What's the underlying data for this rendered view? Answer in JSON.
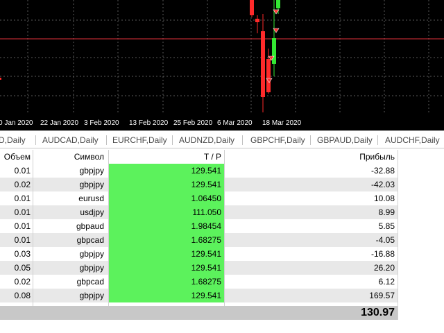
{
  "chart": {
    "background": "#000000",
    "grid_color": "#5a5a5a",
    "hline_color": "#e0303a",
    "bull_color": "#33e833",
    "bear_color": "#ff2a2a",
    "x_labels": [
      "0 Jan 2020",
      "22 Jan 2020",
      "3 Feb 2020",
      "13 Feb 2020",
      "25 Feb 2020",
      "6 Mar 2020",
      "18 Mar 2020"
    ]
  },
  "tabs": [
    {
      "label": "D,Daily"
    },
    {
      "label": "AUDCAD,Daily"
    },
    {
      "label": "EURCHF,Daily"
    },
    {
      "label": "AUDNZD,Daily"
    },
    {
      "label": "GBPCHF,Daily"
    },
    {
      "label": "GBPAUD,Daily"
    },
    {
      "label": "AUDCHF,Daily"
    }
  ],
  "table": {
    "headers": {
      "volume": "Объем",
      "symbol": "Символ",
      "tp": "T / P",
      "profit": "Прибыль"
    },
    "rows": [
      {
        "volume": "0.01",
        "symbol": "gbpjpy",
        "tp": "129.541",
        "profit": "-32.88"
      },
      {
        "volume": "0.02",
        "symbol": "gbpjpy",
        "tp": "129.541",
        "profit": "-42.03"
      },
      {
        "volume": "0.01",
        "symbol": "eurusd",
        "tp": "1.06450",
        "profit": "10.08"
      },
      {
        "volume": "0.01",
        "symbol": "usdjpy",
        "tp": "111.050",
        "profit": "8.99"
      },
      {
        "volume": "0.01",
        "symbol": "gbpaud",
        "tp": "1.98454",
        "profit": "5.85"
      },
      {
        "volume": "0.01",
        "symbol": "gbpcad",
        "tp": "1.68275",
        "profit": "-4.05"
      },
      {
        "volume": "0.03",
        "symbol": "gbpjpy",
        "tp": "129.541",
        "profit": "-16.88"
      },
      {
        "volume": "0.05",
        "symbol": "gbpjpy",
        "tp": "129.541",
        "profit": "26.20"
      },
      {
        "volume": "0.02",
        "symbol": "gbpcad",
        "tp": "1.68275",
        "profit": "6.12"
      },
      {
        "volume": "0.08",
        "symbol": "gbpjpy",
        "tp": "129.541",
        "profit": "169.57"
      }
    ],
    "total": "130.97",
    "tp_color": "#5cf25c"
  }
}
